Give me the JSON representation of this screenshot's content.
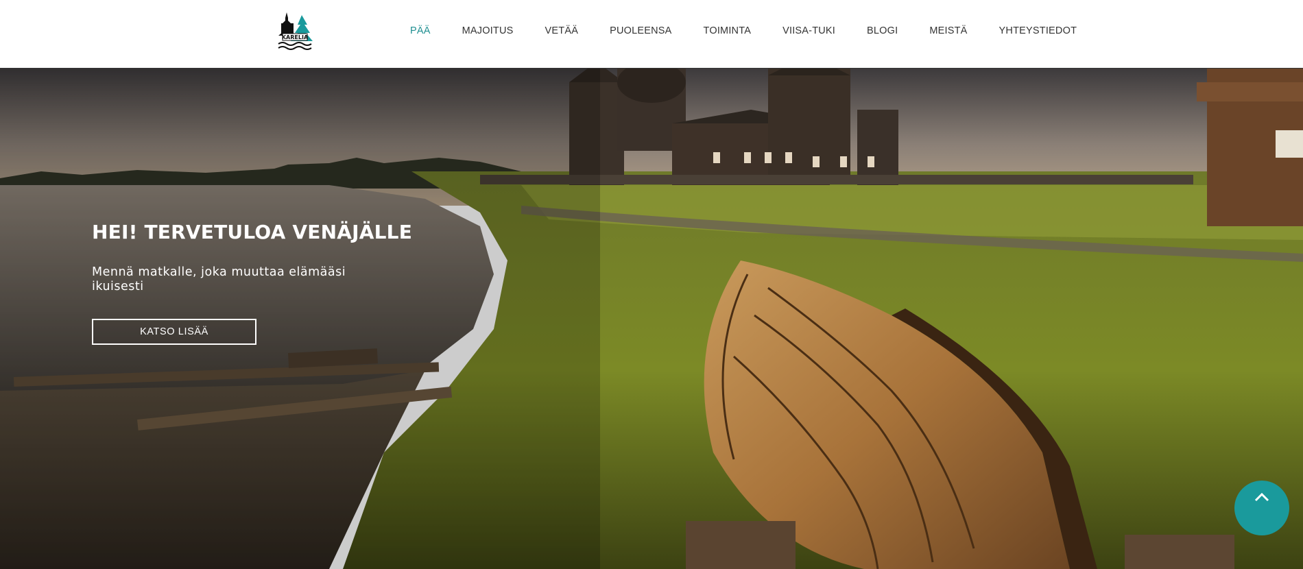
{
  "header": {
    "logo_icon": "karelia-logo-icon",
    "logo_text": "KARELIA",
    "nav": [
      {
        "label": "PÄÄ",
        "active": true
      },
      {
        "label": "MAJOITUS",
        "active": false
      },
      {
        "label": "VETÄÄ",
        "active": false
      },
      {
        "label": "PUOLEENSA",
        "active": false
      },
      {
        "label": "TOIMINTA",
        "active": false
      },
      {
        "label": "VIISA-TUKI",
        "active": false
      },
      {
        "label": "BLOGI",
        "active": false
      },
      {
        "label": "MEISTÄ",
        "active": false
      },
      {
        "label": "YHTEYSTIEDOT",
        "active": false
      }
    ]
  },
  "hero": {
    "title": "HEI! TERVETULOA VENÄJÄLLE",
    "subtitle": "Mennä matkalle, joka muuttaa elämääsi ikuisesti",
    "button_label": "KATSO LISÄÄ",
    "image_icon": "kizhi-landscape-with-boat-image"
  },
  "scroll_top": {
    "icon": "chevron-up-icon"
  },
  "colors": {
    "accent": "#1f8f91",
    "nav_text": "#333333",
    "hero_text": "#ffffff",
    "scroll_button": "#1a9a9c"
  }
}
